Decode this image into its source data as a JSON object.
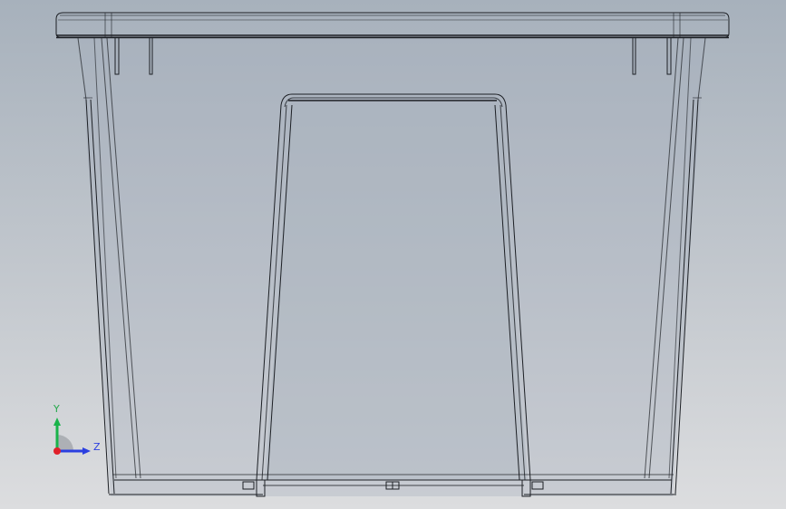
{
  "viewport": {
    "colors": {
      "background_top": "#a7b1bc",
      "background_bottom": "#dcdddf",
      "model_edge": "#1c1f24",
      "model_fill": "#a5afbb"
    }
  },
  "triad": {
    "y_label": "Y",
    "z_label": "Z",
    "colors": {
      "y_axis": "#19b34a",
      "z_axis": "#2b3fe0",
      "x_axis": "#e0202a",
      "y_text": "#23a84a",
      "z_text": "#2b3fe0"
    }
  }
}
